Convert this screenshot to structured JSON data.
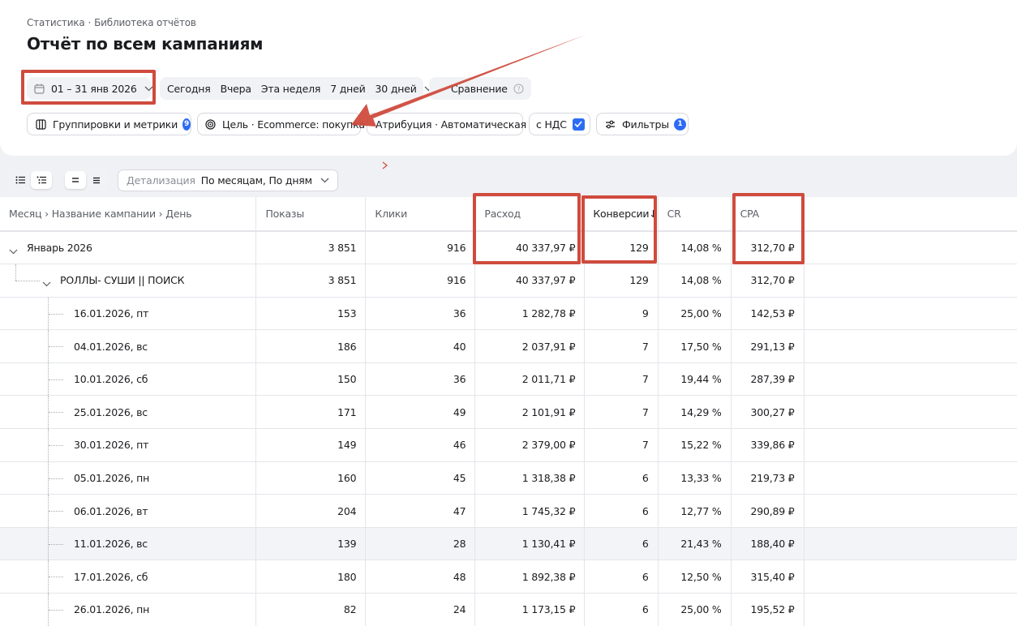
{
  "breadcrumb": {
    "items": [
      "Статистика",
      "Библиотека отчётов"
    ],
    "separator": "·"
  },
  "title": "Отчёт по всем кампаниям",
  "date_range": {
    "label": "01 – 31 янв 2026",
    "icon": "calendar-icon"
  },
  "periods": [
    "Сегодня",
    "Вчера",
    "Эта неделя",
    "7 дней",
    "30 дней"
  ],
  "compare": {
    "label": "Сравнение",
    "icon": "help-icon"
  },
  "filters_row": {
    "groupings": {
      "label": "Группировки и метрики",
      "badge": "9"
    },
    "goal": {
      "label": "Цель · Ecommerce: покупка"
    },
    "attribution": {
      "label": "Атрибуция · Автоматическая"
    },
    "vat": {
      "label": "с НДС",
      "checked": true
    },
    "filters": {
      "label": "Фильтры",
      "badge": "1"
    }
  },
  "detail": {
    "label": "Детализация",
    "value": "По месяцам, По дням"
  },
  "table": {
    "columns": [
      "Месяц › Название кампании › День",
      "Показы",
      "Клики",
      "Расход",
      "Конверсии↓",
      "CR",
      "CPA"
    ],
    "month_row": {
      "name": "Январь 2026",
      "values": [
        "3 851",
        "916",
        "40 337,97 ₽",
        "129",
        "14,08 %",
        "312,70 ₽"
      ]
    },
    "campaign_row": {
      "name": "РОЛЛЫ- СУШИ || ПОИСК",
      "values": [
        "3 851",
        "916",
        "40 337,97 ₽",
        "129",
        "14,08 %",
        "312,70 ₽"
      ]
    },
    "day_rows": [
      {
        "name": "16.01.2026, пт",
        "values": [
          "153",
          "36",
          "1 282,78 ₽",
          "9",
          "25,00 %",
          "142,53 ₽"
        ]
      },
      {
        "name": "04.01.2026, вс",
        "values": [
          "186",
          "40",
          "2 037,91 ₽",
          "7",
          "17,50 %",
          "291,13 ₽"
        ]
      },
      {
        "name": "10.01.2026, сб",
        "values": [
          "150",
          "36",
          "2 011,71 ₽",
          "7",
          "19,44 %",
          "287,39 ₽"
        ]
      },
      {
        "name": "25.01.2026, вс",
        "values": [
          "171",
          "49",
          "2 101,91 ₽",
          "7",
          "14,29 %",
          "300,27 ₽"
        ]
      },
      {
        "name": "30.01.2026, пт",
        "values": [
          "149",
          "46",
          "2 379,00 ₽",
          "7",
          "15,22 %",
          "339,86 ₽"
        ]
      },
      {
        "name": "05.01.2026, пн",
        "values": [
          "160",
          "45",
          "1 318,38 ₽",
          "6",
          "13,33 %",
          "219,73 ₽"
        ]
      },
      {
        "name": "06.01.2026, вт",
        "values": [
          "204",
          "47",
          "1 745,32 ₽",
          "6",
          "12,77 %",
          "290,89 ₽"
        ]
      },
      {
        "name": "11.01.2026, вс",
        "values": [
          "139",
          "28",
          "1 130,41 ₽",
          "6",
          "21,43 %",
          "188,40 ₽"
        ]
      },
      {
        "name": "17.01.2026, сб",
        "values": [
          "180",
          "48",
          "1 892,38 ₽",
          "6",
          "12,50 %",
          "315,40 ₽"
        ]
      },
      {
        "name": "26.01.2026, пн",
        "values": [
          "82",
          "24",
          "1 173,15 ₽",
          "6",
          "25,00 %",
          "195,52 ₽"
        ]
      }
    ]
  },
  "colors": {
    "accent": "#2c6bf5",
    "annotation": "#cf4b3d",
    "highlight_row": "#f3f4f7"
  }
}
